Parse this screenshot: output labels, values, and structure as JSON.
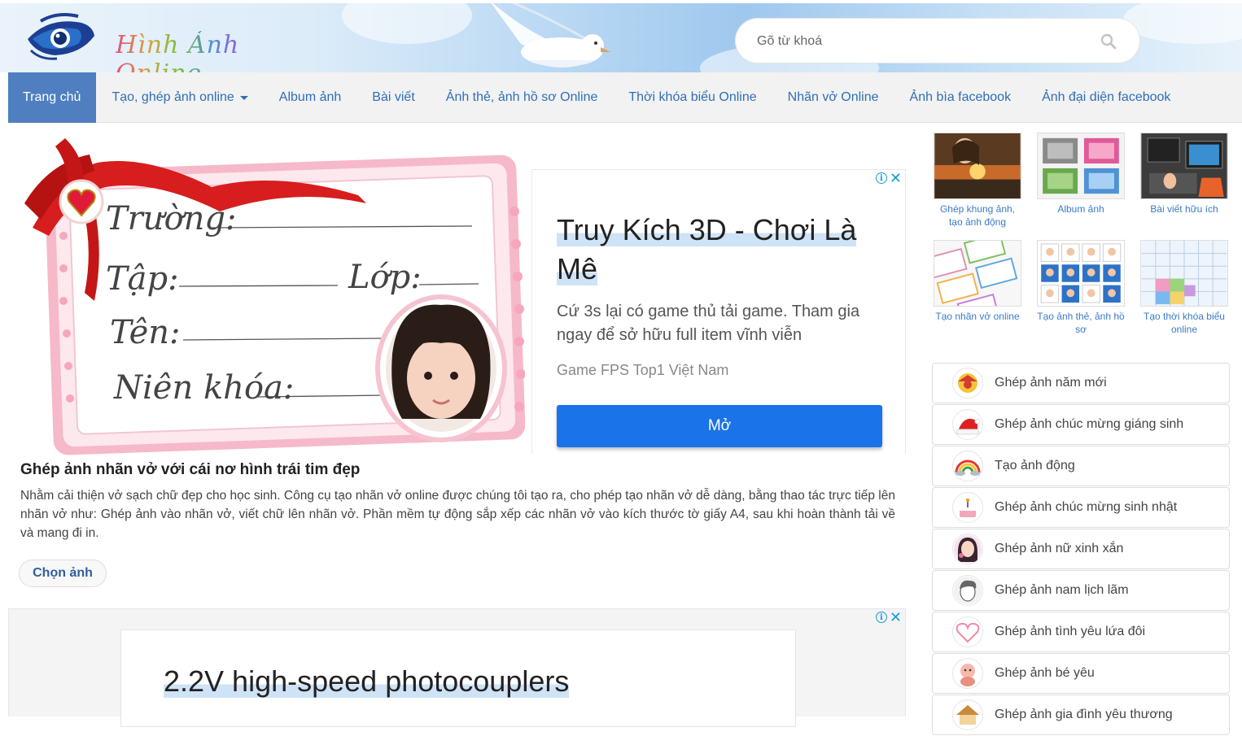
{
  "header": {
    "logo_text": "Hình Ảnh Online",
    "search": {
      "placeholder": "Gõ từ khoá",
      "value": ""
    }
  },
  "nav": {
    "items": [
      {
        "label": "Trang chủ",
        "active": true
      },
      {
        "label": "Tạo, ghép ảnh online",
        "dropdown": true
      },
      {
        "label": "Album ảnh"
      },
      {
        "label": "Bài viết"
      },
      {
        "label": "Ảnh thẻ, ảnh hồ sơ Online"
      },
      {
        "label": "Thời khóa biểu Online"
      },
      {
        "label": "Nhãn vở Online"
      },
      {
        "label": "Ảnh bìa facebook"
      },
      {
        "label": "Ảnh đại diện facebook"
      }
    ]
  },
  "feature": {
    "label_lines": [
      "Trường:",
      "Tập:",
      "Lớp:",
      "Tên:",
      "Niên khóa:"
    ],
    "title": "Ghép ảnh nhãn vở với cái nơ hình trái tim đẹp",
    "description": "Nhằm cải thiện vở sạch chữ đẹp cho học sinh. Công cụ tạo nhãn vở online được chúng tôi tạo ra, cho phép tạo nhãn vở dễ dàng, bằng thao tác trực tiếp lên nhãn vở như: Ghép ảnh vào nhãn vở, viết chữ lên nhãn vở. Phần mềm tự động sắp xếp các nhãn vở vào kích thước tờ giấy A4, sau khi hoàn thành tải về và mang đi in.",
    "button": "Chọn ảnh"
  },
  "ad1": {
    "title": "Truy Kích 3D - Chơi Là Mê",
    "description": "Cứ 3s lại có game thủ tải game. Tham gia ngay để sở hữu full item vĩnh viễn",
    "source": "Game FPS Top1 Việt Nam",
    "button": "Mở"
  },
  "ad2": {
    "title": "2.2V high-speed photocouplers"
  },
  "sidebar": {
    "tiles": [
      {
        "label": "Ghép khung ảnh, tạo ảnh động"
      },
      {
        "label": "Album ảnh"
      },
      {
        "label": "Bài viết hữu ích"
      },
      {
        "label": "Tạo nhãn vở online"
      },
      {
        "label": "Tạo ảnh thẻ, ảnh hồ sơ"
      },
      {
        "label": "Tạo thời khóa biểu online"
      }
    ],
    "list": [
      {
        "label": "Ghép ảnh năm mới",
        "icon": "new-year-icon"
      },
      {
        "label": "Ghép ảnh chúc mừng giáng sinh",
        "icon": "santa-hat-icon"
      },
      {
        "label": "Tạo ảnh động",
        "icon": "rainbow-icon"
      },
      {
        "label": "Ghép ảnh chúc mừng sinh nhật",
        "icon": "cake-icon"
      },
      {
        "label": "Ghép ảnh nữ xinh xắn",
        "icon": "girl-icon"
      },
      {
        "label": "Ghép ảnh nam lịch lãm",
        "icon": "boy-icon"
      },
      {
        "label": "Ghép ảnh tình yêu lứa đôi",
        "icon": "heart-icon"
      },
      {
        "label": "Ghép ảnh bé yêu",
        "icon": "baby-icon"
      },
      {
        "label": "Ghép ảnh gia đình yêu thương",
        "icon": "house-icon"
      }
    ]
  },
  "colors": {
    "nav_active": "#4f7fc1",
    "link": "#2f6fb5",
    "ad_button": "#1a73e8"
  }
}
